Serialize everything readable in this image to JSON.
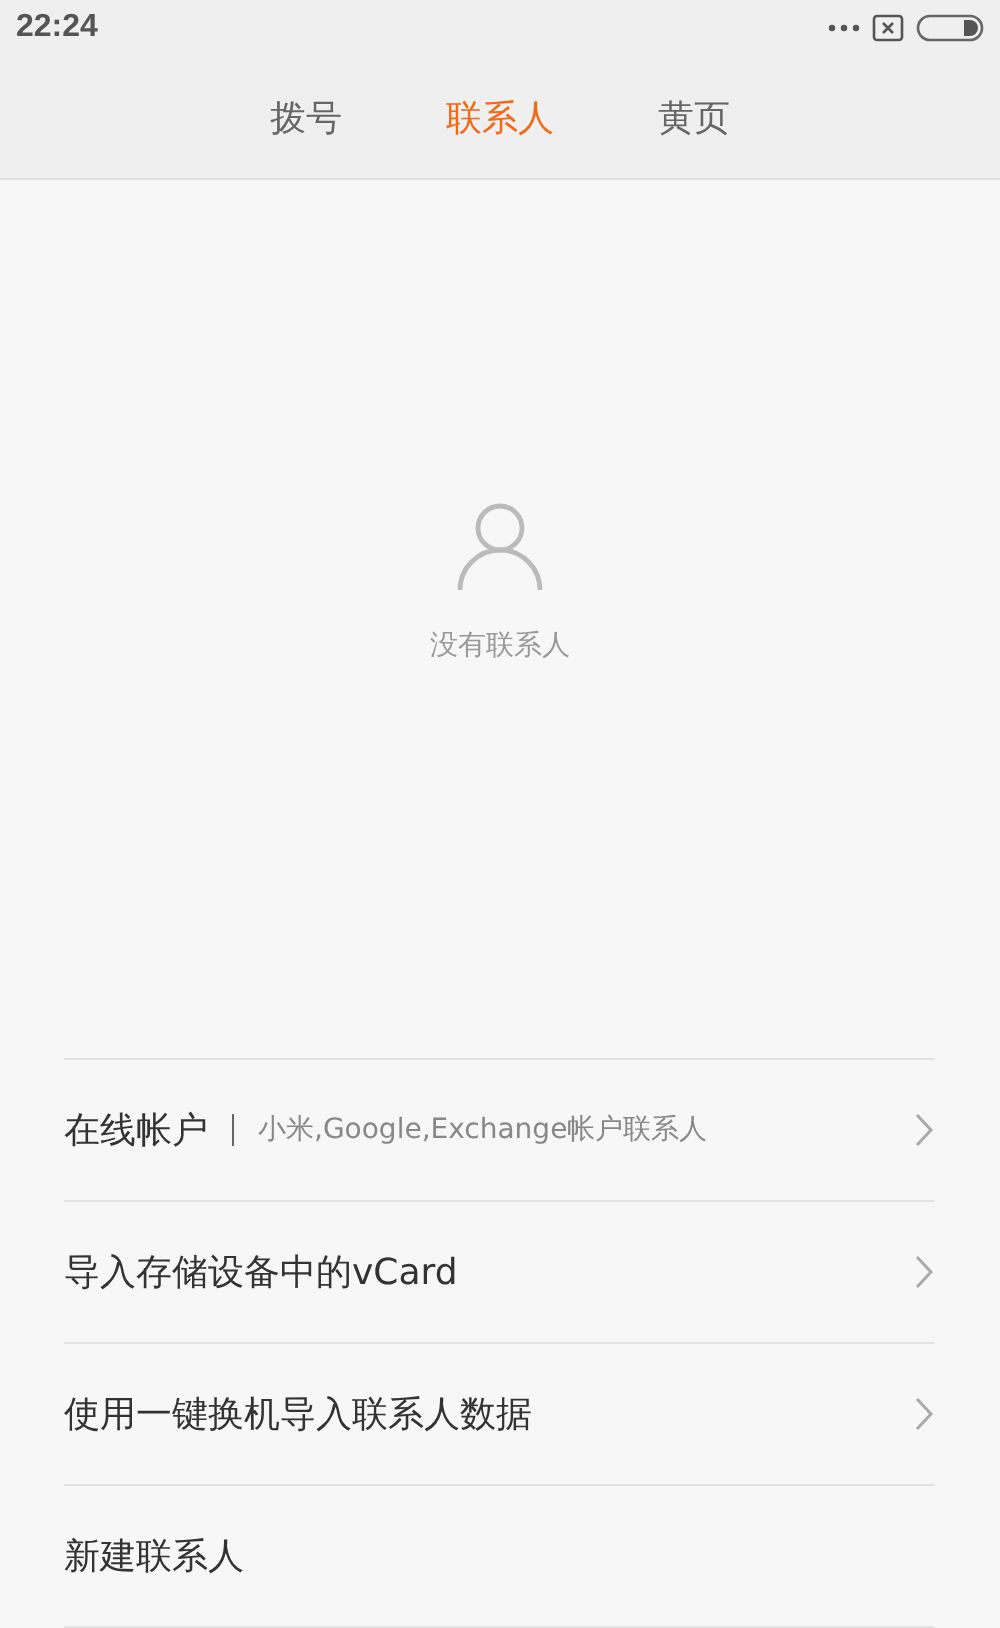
{
  "status_bar": {
    "time": "22:24"
  },
  "tabs": [
    {
      "label": "拨号",
      "selected": false
    },
    {
      "label": "联系人",
      "selected": true
    },
    {
      "label": "黄页",
      "selected": false
    }
  ],
  "empty_state": {
    "message": "没有联系人"
  },
  "actions": [
    {
      "label": "在线帐户",
      "detail": "小米,Google,Exchange帐户联系人",
      "chevron": true
    },
    {
      "label": "导入存储设备中的vCard",
      "chevron": true
    },
    {
      "label": "使用一键换机导入联系人数据",
      "chevron": true
    },
    {
      "label": "新建联系人",
      "chevron": false
    }
  ]
}
